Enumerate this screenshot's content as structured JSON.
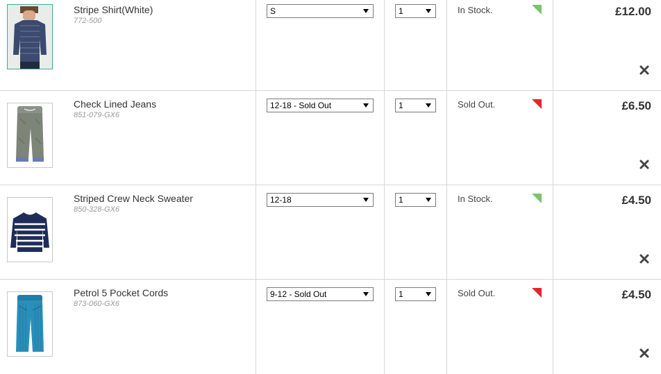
{
  "colors": {
    "in_stock_flag": "#7ac46b",
    "sold_out_flag": "#e8232a",
    "selected_thumb_border": "#3aa8a0"
  },
  "basket": {
    "items": [
      {
        "name": "Stripe Shirt(White)",
        "code": "772-500",
        "size": "S",
        "quantity": "1",
        "stock": "In Stock.",
        "stock_status": "in-stock",
        "price": "£12.00",
        "image": "stripe-shirt-photo"
      },
      {
        "name": "Check Lined Jeans",
        "code": "851-079-GX6",
        "size": "12-18 - Sold Out",
        "quantity": "1",
        "stock": "Sold Out.",
        "stock_status": "sold-out",
        "price": "£6.50",
        "image": "check-lined-jeans-photo"
      },
      {
        "name": "Striped Crew Neck Sweater",
        "code": "850-328-GX6",
        "size": "12-18",
        "quantity": "1",
        "stock": "In Stock.",
        "stock_status": "in-stock",
        "price": "£4.50",
        "image": "striped-sweater-photo"
      },
      {
        "name": "Petrol 5 Pocket Cords",
        "code": "873-060-GX6",
        "size": "9-12 - Sold Out",
        "quantity": "1",
        "stock": "Sold Out.",
        "stock_status": "sold-out",
        "price": "£4.50",
        "image": "petrol-cords-photo"
      }
    ]
  }
}
